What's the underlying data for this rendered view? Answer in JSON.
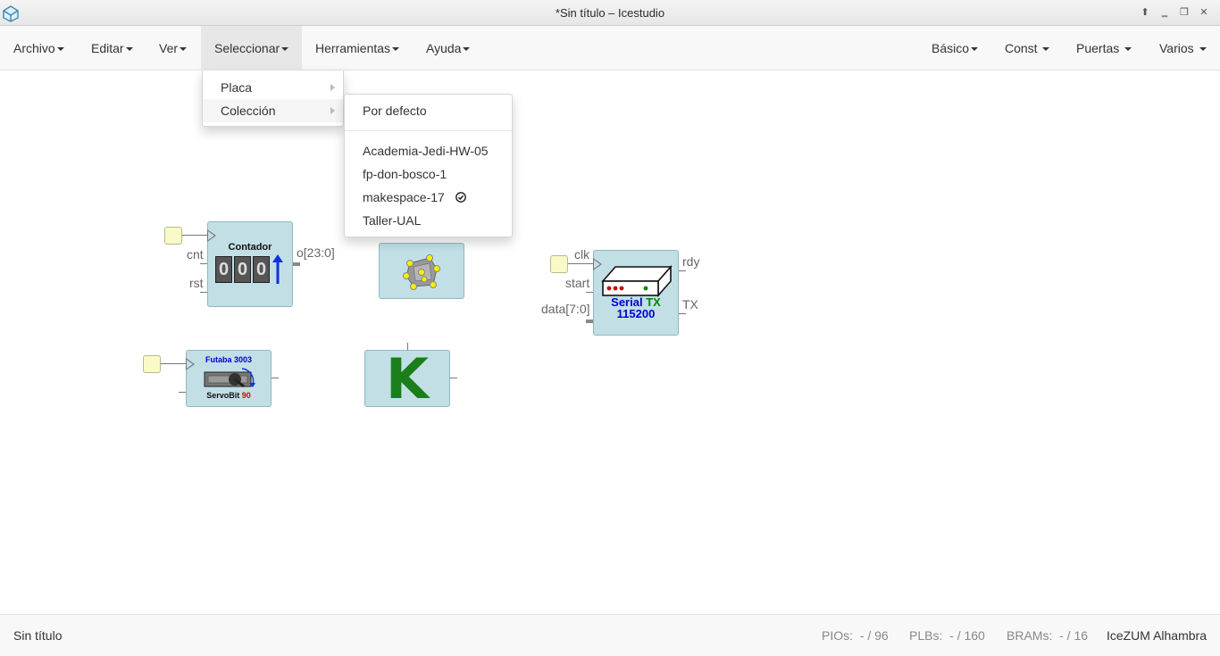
{
  "window": {
    "title": "*Sin título – Icestudio",
    "controls": [
      "up-icon",
      "minimize-icon",
      "restore-icon"
    ]
  },
  "menubar": {
    "left": [
      "Archivo",
      "Editar",
      "Ver",
      "Seleccionar",
      "Herramientas",
      "Ayuda"
    ],
    "right": [
      "Básico",
      "Const",
      "Puertas",
      "Varios"
    ],
    "active": "Seleccionar"
  },
  "seleccionar_menu": {
    "items": [
      "Placa",
      "Colección"
    ],
    "hovered": "Colección"
  },
  "coleccion_submenu": {
    "default_item": "Por defecto",
    "collections": [
      "Academia-Jedi-HW-05",
      "fp-don-bosco-1",
      "makespace-17",
      "Taller-UAL"
    ],
    "selected": "makespace-17"
  },
  "canvas": {
    "contador": {
      "title": "Contador",
      "inputs": [
        "cnt",
        "rst"
      ],
      "output": "o[23:0]",
      "digits": [
        "0",
        "0",
        "0"
      ]
    },
    "serial_tx": {
      "inputs": [
        "clk",
        "start",
        "data[7:0]"
      ],
      "outputs": [
        "rdy",
        "TX"
      ],
      "label_serial": "Serial",
      "label_tx": "TX",
      "label_baud": "115200"
    },
    "servo": {
      "label_top": "Futaba 3003",
      "label_bottom": "ServoBit",
      "label_value": "90"
    },
    "k_block": {
      "letter": "K"
    },
    "colors": {
      "block_bg": "#c2dfe6",
      "input_bg": "#fafac8",
      "k_green": "#1a7f1a",
      "serial_blue": "#0000cc",
      "tx_green": "#008800",
      "servo_red": "#dd0000"
    }
  },
  "status": {
    "filename": "Sin título",
    "pios_label": "PIOs:",
    "pios_value": "- / 96",
    "plbs_label": "PLBs:",
    "plbs_value": "- / 160",
    "brams_label": "BRAMs:",
    "brams_value": "- / 16",
    "board": "IceZUM Alhambra"
  }
}
